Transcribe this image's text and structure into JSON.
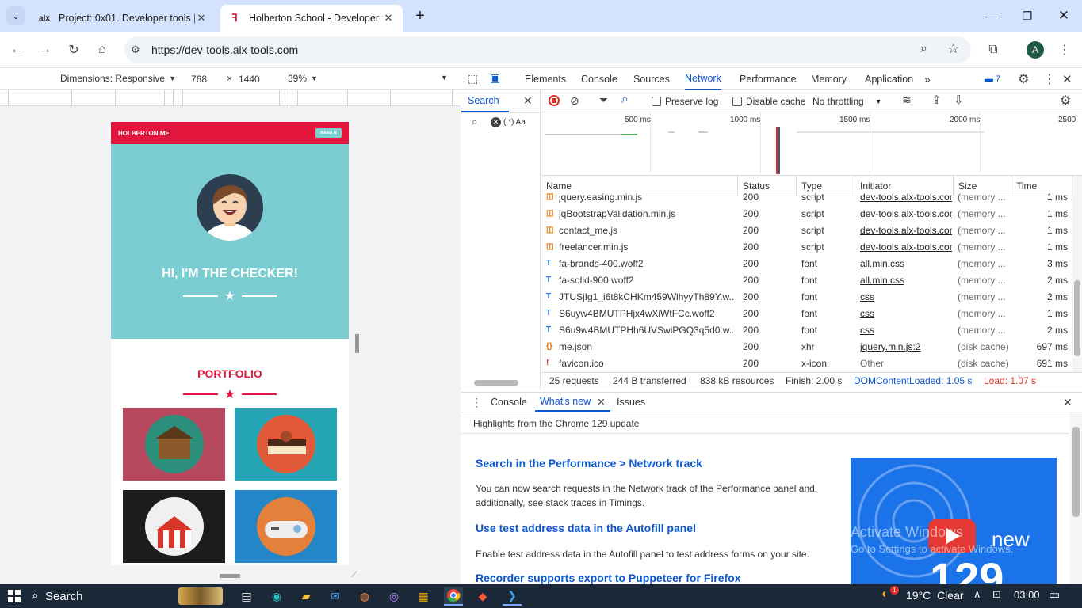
{
  "tabs": [
    {
      "title": "Project: 0x01. Developer tools |",
      "favicon": "alx"
    },
    {
      "title": "Holberton School - Developer t",
      "favicon": "H"
    }
  ],
  "toolbar": {
    "url": "https://dev-tools.alx-tools.com",
    "profile_initial": "A"
  },
  "device_toolbar": {
    "dimensions": "Dimensions: Responsive",
    "width": "768",
    "height": "1440",
    "times": "×",
    "zoom": "39%"
  },
  "site": {
    "brand": "HOLBERTON ME",
    "menu": "MENU ☰",
    "hero_title": "HI, I'M THE CHECKER!",
    "portfolio_title": "PORTFOLIO"
  },
  "devtools": {
    "tabs": [
      "Elements",
      "Console",
      "Sources",
      "Network",
      "Performance",
      "Memory",
      "Application"
    ],
    "active_tab": "Network",
    "issues_count": "7",
    "search_label": "Search",
    "search_options": "(.*)  Aa",
    "toolbar": {
      "preserve_log": "Preserve log",
      "disable_cache": "Disable cache",
      "throttling": "No throttling"
    },
    "overview_ticks": [
      "500 ms",
      "1000 ms",
      "1500 ms",
      "2000 ms",
      "2500"
    ],
    "columns": [
      "Name",
      "Status",
      "Type",
      "Initiator",
      "Size",
      "Time"
    ],
    "rows": [
      {
        "name": "jquery.easing.min.js",
        "status": "200",
        "type": "script",
        "initiator": "dev-tools.alx-tools.com",
        "size": "(memory ...",
        "time": "1 ms",
        "kind": "script"
      },
      {
        "name": "jqBootstrapValidation.min.js",
        "status": "200",
        "type": "script",
        "initiator": "dev-tools.alx-tools.com",
        "size": "(memory ...",
        "time": "1 ms",
        "kind": "script"
      },
      {
        "name": "contact_me.js",
        "status": "200",
        "type": "script",
        "initiator": "dev-tools.alx-tools.com",
        "size": "(memory ...",
        "time": "1 ms",
        "kind": "script"
      },
      {
        "name": "freelancer.min.js",
        "status": "200",
        "type": "script",
        "initiator": "dev-tools.alx-tools.com",
        "size": "(memory ...",
        "time": "1 ms",
        "kind": "script"
      },
      {
        "name": "fa-brands-400.woff2",
        "status": "200",
        "type": "font",
        "initiator": "all.min.css",
        "size": "(memory ...",
        "time": "3 ms",
        "kind": "font"
      },
      {
        "name": "fa-solid-900.woff2",
        "status": "200",
        "type": "font",
        "initiator": "all.min.css",
        "size": "(memory ...",
        "time": "2 ms",
        "kind": "font"
      },
      {
        "name": "JTUSjIg1_i6t8kCHKm459WlhyyTh89Y.w...",
        "status": "200",
        "type": "font",
        "initiator": "css",
        "size": "(memory ...",
        "time": "2 ms",
        "kind": "font"
      },
      {
        "name": "S6uyw4BMUTPHjx4wXiWtFCc.woff2",
        "status": "200",
        "type": "font",
        "initiator": "css",
        "size": "(memory ...",
        "time": "1 ms",
        "kind": "font"
      },
      {
        "name": "S6u9w4BMUTPHh6UVSwiPGQ3q5d0.w...",
        "status": "200",
        "type": "font",
        "initiator": "css",
        "size": "(memory ...",
        "time": "2 ms",
        "kind": "font"
      },
      {
        "name": "me.json",
        "status": "200",
        "type": "xhr",
        "initiator": "jquery.min.js:2",
        "size": "(disk cache)",
        "time": "697 ms",
        "kind": "xhr"
      },
      {
        "name": "favicon.ico",
        "status": "200",
        "type": "x-icon",
        "initiator": "Other",
        "size": "(disk cache)",
        "time": "691 ms",
        "kind": "icon"
      }
    ],
    "status_bar": {
      "requests": "25 requests",
      "transferred": "244 B transferred",
      "resources": "838 kB resources",
      "finish": "Finish: 2.00 s",
      "dcl": "DOMContentLoaded: 1.05 s",
      "load": "Load: 1.07 s"
    },
    "drawer": {
      "tabs": [
        "Console",
        "What's new",
        "Issues"
      ],
      "active": "What's new",
      "highlight": "Highlights from the Chrome 129 update",
      "items": [
        {
          "title": "Search in the Performance > Network track",
          "body": "You can now search requests in the Network track of the Performance panel and, additionally, see stack traces in Timings."
        },
        {
          "title": "Use test address data in the Autofill panel",
          "body": "Enable test address data in the Autofill panel to test address forms on your site."
        },
        {
          "title": "Recorder supports export to Puppeteer for Firefox",
          "body": ""
        }
      ],
      "video_text": "new",
      "video_number": "129",
      "watermark_1": "Activate Windows",
      "watermark_2": "Go to Settings to activate Windows."
    }
  },
  "taskbar": {
    "search": "Search",
    "weather": "19°C  Clear",
    "time": "03:00",
    "badge": "1"
  },
  "colors": {
    "accent": "#0b57d0",
    "brand": "#e3173e",
    "teal": "#7bcdd2",
    "load": "#d93025"
  }
}
